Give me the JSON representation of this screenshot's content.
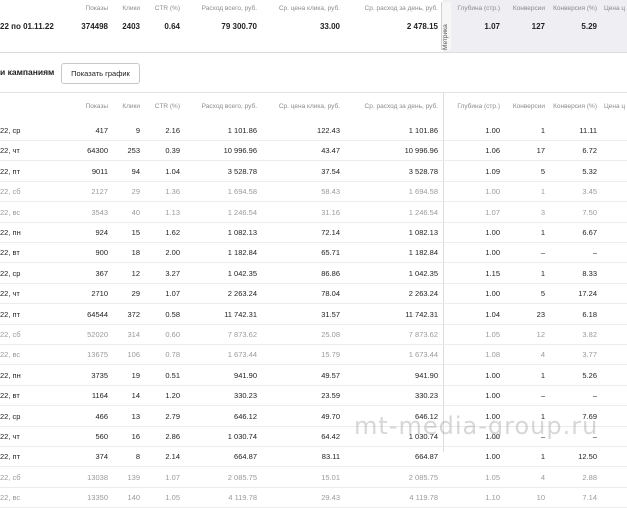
{
  "summary": {
    "period": "22 по 01.11.22",
    "metrika_label": "Метрика",
    "headers": [
      "Показы",
      "Клики",
      "CTR (%)",
      "Расход всего, руб.",
      "Ср. цена клика, руб.",
      "Ср. расход за день, руб.",
      "Глубина (стр.)",
      "Конверсии",
      "Конверсия (%)",
      "Цена ц"
    ],
    "values": [
      "374498",
      "2403",
      "0.64",
      "79 300.70",
      "33.00",
      "2 478.15",
      "1.07",
      "127",
      "5.29",
      ""
    ]
  },
  "campaigns": {
    "title": "и кампаниям",
    "show_chart_button": "Показать график"
  },
  "table": {
    "headers": [
      "Показы",
      "Клики",
      "CTR (%)",
      "Расход всего, руб.",
      "Ср. цена клика, руб.",
      "Ср. расход за день, руб.",
      "Глубина (стр.)",
      "Конверсии",
      "Конверсия (%)",
      "Цена ц"
    ],
    "rows": [
      {
        "date": "22, ср",
        "weekend": false,
        "cells": [
          "417",
          "9",
          "2.16",
          "1 101.86",
          "122.43",
          "1 101.86",
          "1.00",
          "1",
          "11.11"
        ]
      },
      {
        "date": "22, чт",
        "weekend": false,
        "cells": [
          "64300",
          "253",
          "0.39",
          "10 996.96",
          "43.47",
          "10 996.96",
          "1.06",
          "17",
          "6.72"
        ]
      },
      {
        "date": "22, пт",
        "weekend": false,
        "cells": [
          "9011",
          "94",
          "1.04",
          "3 528.78",
          "37.54",
          "3 528.78",
          "1.09",
          "5",
          "5.32"
        ]
      },
      {
        "date": "22, сб",
        "weekend": true,
        "cells": [
          "2127",
          "29",
          "1.36",
          "1 694.58",
          "58.43",
          "1 694.58",
          "1.00",
          "1",
          "3.45"
        ]
      },
      {
        "date": "22, вс",
        "weekend": true,
        "cells": [
          "3543",
          "40",
          "1.13",
          "1 246.54",
          "31.16",
          "1 246.54",
          "1.07",
          "3",
          "7.50"
        ]
      },
      {
        "date": "22, пн",
        "weekend": false,
        "cells": [
          "924",
          "15",
          "1.62",
          "1 082.13",
          "72.14",
          "1 082.13",
          "1.00",
          "1",
          "6.67"
        ]
      },
      {
        "date": "22, вт",
        "weekend": false,
        "cells": [
          "900",
          "18",
          "2.00",
          "1 182.84",
          "65.71",
          "1 182.84",
          "1.00",
          "–",
          "–"
        ]
      },
      {
        "date": "22, ср",
        "weekend": false,
        "cells": [
          "367",
          "12",
          "3.27",
          "1 042.35",
          "86.86",
          "1 042.35",
          "1.15",
          "1",
          "8.33"
        ]
      },
      {
        "date": "22, чт",
        "weekend": false,
        "cells": [
          "2710",
          "29",
          "1.07",
          "2 263.24",
          "78.04",
          "2 263.24",
          "1.00",
          "5",
          "17.24"
        ]
      },
      {
        "date": "22, пт",
        "weekend": false,
        "cells": [
          "64544",
          "372",
          "0.58",
          "11 742.31",
          "31.57",
          "11 742.31",
          "1.04",
          "23",
          "6.18"
        ]
      },
      {
        "date": "22, сб",
        "weekend": true,
        "cells": [
          "52020",
          "314",
          "0.60",
          "7 873.62",
          "25.08",
          "7 873.62",
          "1.05",
          "12",
          "3.82"
        ]
      },
      {
        "date": "22, вс",
        "weekend": true,
        "cells": [
          "13675",
          "106",
          "0.78",
          "1 673.44",
          "15.79",
          "1 673.44",
          "1.08",
          "4",
          "3.77"
        ]
      },
      {
        "date": "22, пн",
        "weekend": false,
        "cells": [
          "3735",
          "19",
          "0.51",
          "941.90",
          "49.57",
          "941.90",
          "1.00",
          "1",
          "5.26"
        ]
      },
      {
        "date": "22, вт",
        "weekend": false,
        "cells": [
          "1164",
          "14",
          "1.20",
          "330.23",
          "23.59",
          "330.23",
          "1.00",
          "–",
          "–"
        ]
      },
      {
        "date": "22, ср",
        "weekend": false,
        "cells": [
          "466",
          "13",
          "2.79",
          "646.12",
          "49.70",
          "646.12",
          "1.00",
          "1",
          "7.69"
        ]
      },
      {
        "date": "22, чт",
        "weekend": false,
        "cells": [
          "560",
          "16",
          "2.86",
          "1 030.74",
          "64.42",
          "1 030.74",
          "1.00",
          "–",
          "–"
        ]
      },
      {
        "date": "22, пт",
        "weekend": false,
        "cells": [
          "374",
          "8",
          "2.14",
          "664.87",
          "83.11",
          "664.87",
          "1.00",
          "1",
          "12.50"
        ]
      },
      {
        "date": "22, сб",
        "weekend": true,
        "cells": [
          "13038",
          "139",
          "1.07",
          "2 085.75",
          "15.01",
          "2 085.75",
          "1.05",
          "4",
          "2.88"
        ]
      },
      {
        "date": "22, вс",
        "weekend": true,
        "cells": [
          "13350",
          "140",
          "1.05",
          "4 119.78",
          "29.43",
          "4 119.78",
          "1.10",
          "10",
          "7.14"
        ]
      }
    ]
  },
  "watermark": "mt-media-group.ru"
}
